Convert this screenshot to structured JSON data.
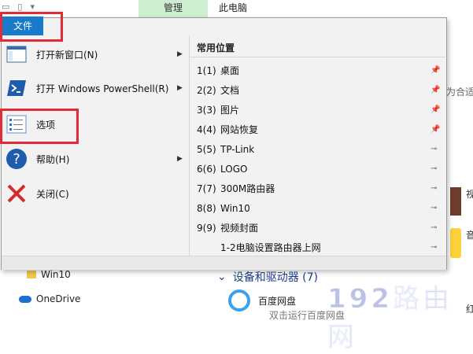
{
  "window": {
    "title": "此电脑",
    "context_tab": "管理"
  },
  "file_tab": {
    "label": "文件"
  },
  "menu_left": [
    {
      "label": "打开新窗口(N)",
      "icon": "new-window-icon",
      "submenu": true
    },
    {
      "label": "打开 Windows PowerShell(R)",
      "icon": "powershell-icon",
      "submenu": true
    },
    {
      "label": "选项",
      "icon": "options-icon",
      "submenu": false
    },
    {
      "label": "帮助(H)",
      "icon": "help-icon",
      "submenu": true
    },
    {
      "label": "关闭(C)",
      "icon": "close-icon",
      "submenu": false
    }
  ],
  "frequent": {
    "header": "常用位置",
    "items": [
      {
        "num": "1(1)",
        "name": "桌面",
        "pinned": true
      },
      {
        "num": "2(2)",
        "name": "文档",
        "pinned": true
      },
      {
        "num": "3(3)",
        "name": "图片",
        "pinned": true
      },
      {
        "num": "4(4)",
        "name": "网站恢复",
        "pinned": true
      },
      {
        "num": "5(5)",
        "name": "TP-Link",
        "pinned": false
      },
      {
        "num": "6(6)",
        "name": "LOGO",
        "pinned": false
      },
      {
        "num": "7(7)",
        "name": "300M路由器",
        "pinned": false
      },
      {
        "num": "8(8)",
        "name": "Win10",
        "pinned": false
      },
      {
        "num": "9(9)",
        "name": "视频封面",
        "pinned": false
      },
      {
        "num": "",
        "name": "1-2电脑设置路由器上网",
        "pinned": false
      }
    ]
  },
  "background": {
    "right_text": "为合适",
    "nav_items": [
      "Win10",
      "OneDrive"
    ],
    "devices_header": "设备和驱动器 (7)",
    "baidu_label": "百度网盘",
    "baidu_sub": "双击运行百度网盘",
    "watermark": "192路由网",
    "side_chars": [
      "视",
      "音",
      "红"
    ]
  },
  "colors": {
    "accent": "#1979ca",
    "annotation": "#e32b37",
    "context_tab": "#cdeed0"
  }
}
